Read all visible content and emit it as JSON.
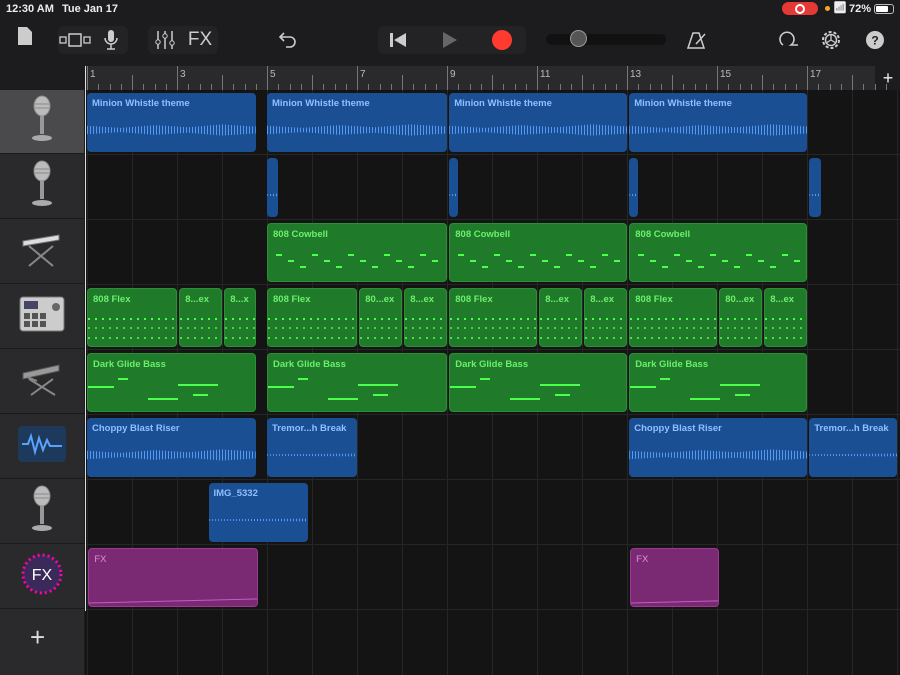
{
  "status": {
    "time": "12:30 AM",
    "date": "Tue Jan 17",
    "battery": "72%",
    "battery_level": 0.72
  },
  "toolbar": {
    "fx_label": "FX",
    "icons": [
      "document-icon",
      "track-view-icon",
      "microphone-icon",
      "mixer-icon",
      "undo-icon",
      "rewind-icon",
      "play-icon",
      "record-icon",
      "metronome-icon",
      "loop-icon",
      "settings-icon",
      "help-icon"
    ],
    "record_color": "#ff3b30",
    "master_volume": 0.1
  },
  "ruler": {
    "bar_labels": [
      "1",
      "3",
      "5",
      "7",
      "9",
      "11",
      "13",
      "15",
      "17"
    ]
  },
  "tracks": [
    {
      "icon": "microphone-icon",
      "selected": true,
      "regions": [
        {
          "type": "audio",
          "label": "Minion Whistle theme",
          "start": 1,
          "end": 4.75
        },
        {
          "type": "audio",
          "label": "Minion Whistle theme",
          "start": 5,
          "end": 9
        },
        {
          "type": "audio",
          "label": "Minion Whistle theme",
          "start": 9.05,
          "end": 13
        },
        {
          "type": "audio",
          "label": "Minion Whistle theme",
          "start": 13.05,
          "end": 17
        }
      ]
    },
    {
      "icon": "microphone-icon",
      "regions": [
        {
          "type": "audio",
          "label": "",
          "start": 5,
          "end": 5.25
        },
        {
          "type": "audio",
          "label": "",
          "start": 9.05,
          "end": 9.25
        },
        {
          "type": "audio",
          "label": "",
          "start": 13.05,
          "end": 13.25
        },
        {
          "type": "audio",
          "label": "",
          "start": 17.05,
          "end": 17.3
        }
      ]
    },
    {
      "icon": "keyboard-icon",
      "regions": [
        {
          "type": "midi",
          "label": "808 Cowbell",
          "start": 5,
          "end": 9
        },
        {
          "type": "midi",
          "label": "808 Cowbell",
          "start": 9.05,
          "end": 13
        },
        {
          "type": "midi",
          "label": "808 Cowbell",
          "start": 13.05,
          "end": 17
        }
      ]
    },
    {
      "icon": "drum-machine-icon",
      "regions": [
        {
          "type": "drum",
          "label": "808 Flex",
          "start": 1,
          "end": 3
        },
        {
          "type": "drum",
          "label": "8...ex",
          "start": 3.05,
          "end": 4
        },
        {
          "type": "drum",
          "label": "8...x",
          "start": 4.05,
          "end": 4.75
        },
        {
          "type": "drum",
          "label": "808 Flex",
          "start": 5,
          "end": 7
        },
        {
          "type": "drum",
          "label": "80...ex",
          "start": 7.05,
          "end": 8
        },
        {
          "type": "drum",
          "label": "8...ex",
          "start": 8.05,
          "end": 9
        },
        {
          "type": "drum",
          "label": "808 Flex",
          "start": 9.05,
          "end": 11
        },
        {
          "type": "drum",
          "label": "8...ex",
          "start": 11.05,
          "end": 12
        },
        {
          "type": "drum",
          "label": "8...ex",
          "start": 12.05,
          "end": 13
        },
        {
          "type": "drum",
          "label": "808 Flex",
          "start": 13.05,
          "end": 15
        },
        {
          "type": "drum",
          "label": "80...ex",
          "start": 15.05,
          "end": 16
        },
        {
          "type": "drum",
          "label": "8...ex",
          "start": 16.05,
          "end": 17
        }
      ]
    },
    {
      "icon": "synth-keyboard-icon",
      "regions": [
        {
          "type": "bass",
          "label": "Dark Glide Bass",
          "start": 1,
          "end": 4.75
        },
        {
          "type": "bass",
          "label": "Dark Glide Bass",
          "start": 5,
          "end": 9
        },
        {
          "type": "bass",
          "label": "Dark Glide Bass",
          "start": 9.05,
          "end": 13
        },
        {
          "type": "bass",
          "label": "Dark Glide Bass",
          "start": 13.05,
          "end": 17
        }
      ]
    },
    {
      "icon": "waveform-icon",
      "regions": [
        {
          "type": "audio-full",
          "label": "Choppy Blast Riser",
          "start": 1,
          "end": 4.75
        },
        {
          "type": "audio",
          "label": "Tremor...h Break",
          "start": 5,
          "end": 7
        },
        {
          "type": "audio-full",
          "label": "Choppy Blast Riser",
          "start": 13.05,
          "end": 17
        },
        {
          "type": "audio",
          "label": "Tremor...h Break",
          "start": 17.05,
          "end": 19
        }
      ]
    },
    {
      "icon": "microphone-icon",
      "regions": [
        {
          "type": "audio",
          "label": "IMG_5332",
          "start": 3.7,
          "end": 5.9
        }
      ]
    },
    {
      "icon": "fx-icon",
      "regions": [
        {
          "type": "fx",
          "label": "FX",
          "start": 1.03,
          "end": 4.8
        },
        {
          "type": "fx",
          "label": "FX",
          "start": 13.07,
          "end": 15.05
        }
      ]
    }
  ]
}
